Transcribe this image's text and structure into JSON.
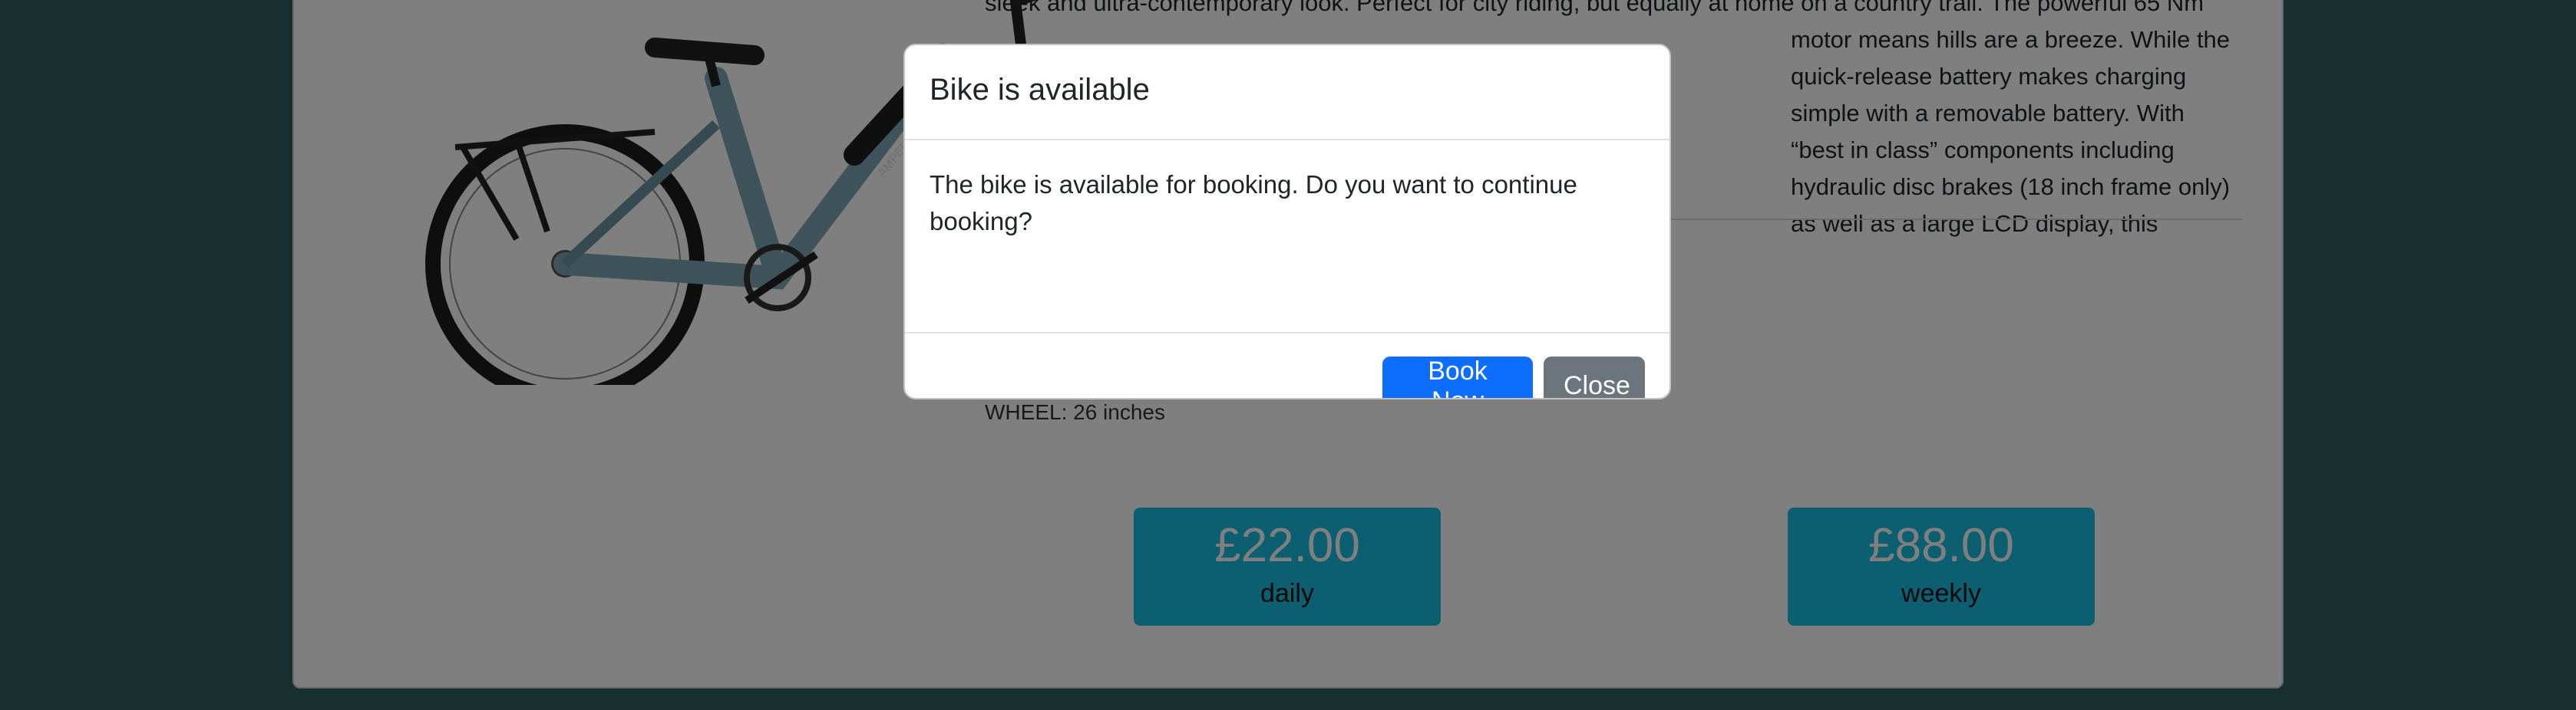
{
  "page": {
    "description_lines": [
      "sleek and ultra-contemporary look. Perfect for city riding, but equally at home on a country trail. The powerful 65 Nm",
      "motor means hills are a breeze. While the quick-release battery makes charging",
      "simple with a removable battery. With “best in class” components including",
      "hydraulic disc brakes (18 inch frame only) as well as a large LCD display, this"
    ],
    "wheel_label": "WHEEL: 26 inches",
    "prices": [
      {
        "amount": "£22.00",
        "period": "daily"
      },
      {
        "amount": "£88.00",
        "period": "weekly"
      }
    ],
    "bike_brand": "AMPERE",
    "colors": {
      "bike_frame": "#7fa6b5",
      "price_box": "#17bfe0",
      "primary": "#0d6efd",
      "secondary": "#6c757d"
    }
  },
  "modal": {
    "title": "Bike is available",
    "body": "The bike is available for booking. Do you want to continue booking?",
    "book_now_label": "Book Now",
    "close_label": "Close"
  }
}
